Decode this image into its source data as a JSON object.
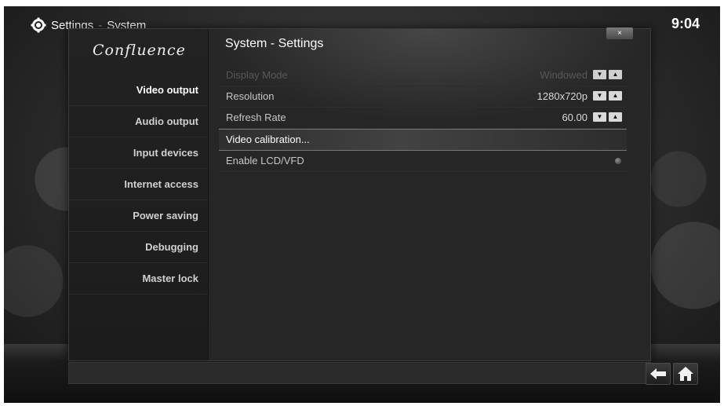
{
  "header": {
    "breadcrumb_root": "Settings",
    "separator": "-",
    "breadcrumb_current": "System",
    "clock": "9:04",
    "icon": "gear-icon"
  },
  "sidebar": {
    "logo": "Confluence",
    "items": [
      {
        "label": "Video output",
        "active": true
      },
      {
        "label": "Audio output"
      },
      {
        "label": "Input devices"
      },
      {
        "label": "Internet access"
      },
      {
        "label": "Power saving"
      },
      {
        "label": "Debugging"
      },
      {
        "label": "Master lock"
      }
    ]
  },
  "dialog": {
    "title": "System - Settings",
    "close_label": "×"
  },
  "settings": [
    {
      "label": "Display Mode",
      "value": "Windowed",
      "control": "spinner",
      "disabled": true
    },
    {
      "label": "Resolution",
      "value": "1280x720p",
      "control": "spinner"
    },
    {
      "label": "Refresh Rate",
      "value": "60.00",
      "control": "spinner"
    },
    {
      "label": "Video calibration...",
      "control": "button",
      "focused": true
    },
    {
      "label": "Enable LCD/VFD",
      "control": "radio",
      "checked": false
    }
  ],
  "spinner": {
    "down": "▼",
    "up": "▲"
  },
  "footer": {
    "back_icon": "back-arrow-icon",
    "home_icon": "home-icon"
  }
}
